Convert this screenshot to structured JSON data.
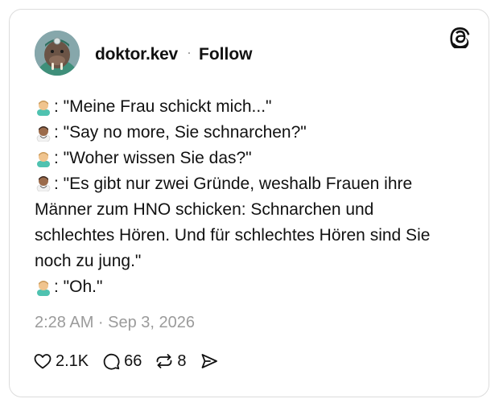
{
  "post": {
    "username": "doktor.kev",
    "separator": "·",
    "follow_label": "Follow",
    "avatar_icon": "walrus-doctor-avatar",
    "lines": [
      {
        "speaker": "patient",
        "text": ": \"Meine Frau schickt mich...\""
      },
      {
        "speaker": "doctor",
        "text": ": \"Say no more, Sie schnarchen?\""
      },
      {
        "speaker": "patient",
        "text": ": \"Woher wissen Sie das?\""
      },
      {
        "speaker": "doctor",
        "text": ": \"Es gibt nur zwei Gründe, weshalb Frauen ihre Männer zum HNO schicken: Schnarchen und schlechtes Hören. Und für schlechtes Hören sind Sie noch zu jung.\""
      },
      {
        "speaker": "patient",
        "text": ": \"Oh.\""
      }
    ],
    "timestamp": "2:28 AM · Sep 3, 2026",
    "likes": "2.1K",
    "replies": "66",
    "reposts": "8"
  },
  "icons": {
    "logo": "threads-logo-icon",
    "like": "heart-icon",
    "reply": "comment-icon",
    "repost": "repost-icon",
    "share": "send-icon"
  }
}
